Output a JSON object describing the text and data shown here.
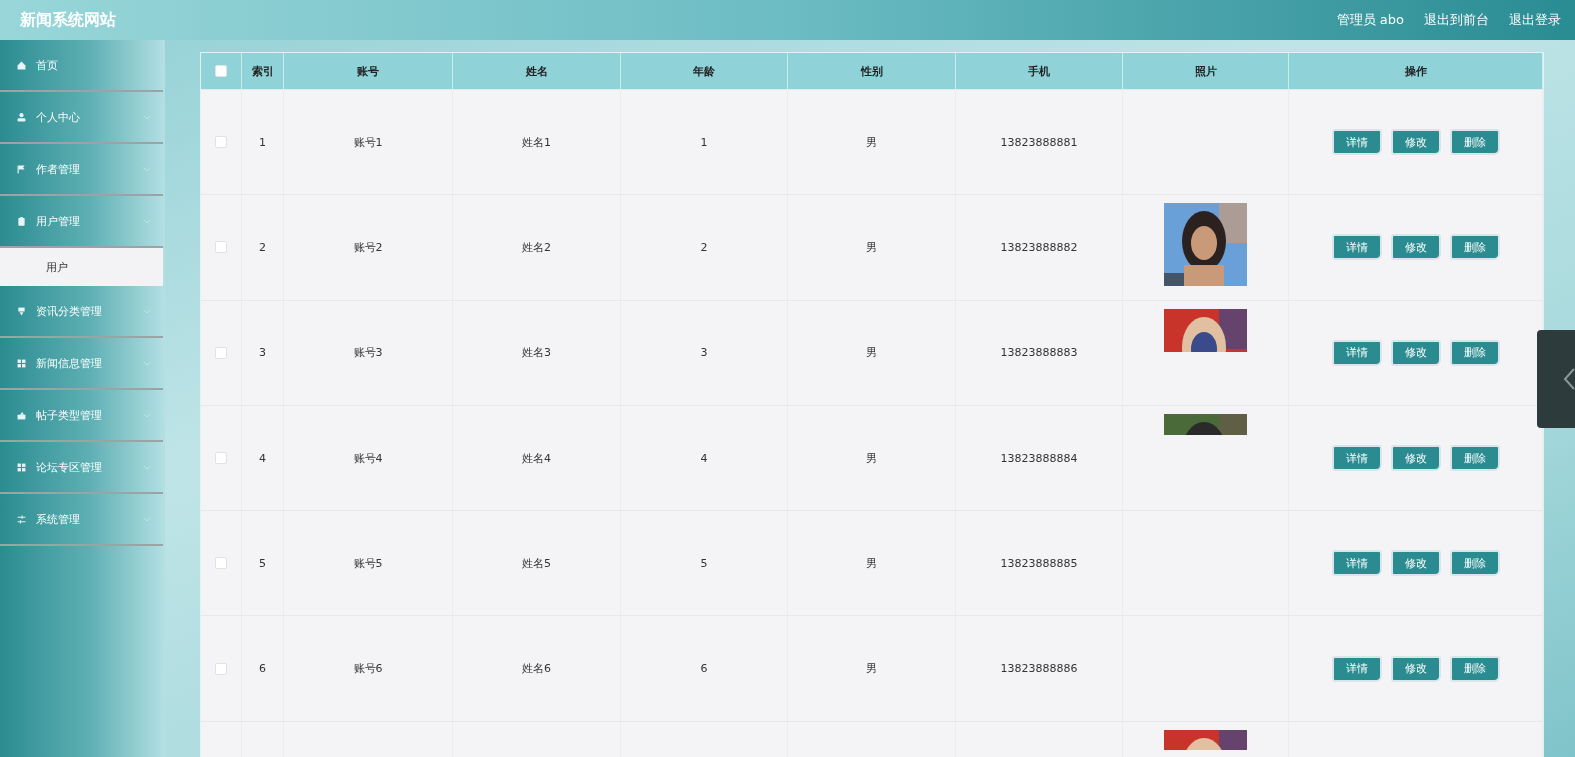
{
  "header": {
    "title": "新闻系统网站",
    "links": [
      {
        "label": "管理员 abo"
      },
      {
        "label": "退出到前台"
      },
      {
        "label": "退出登录"
      }
    ]
  },
  "sidebar": {
    "items": [
      {
        "label": "首页",
        "expandable": false
      },
      {
        "label": "个人中心",
        "expandable": true
      },
      {
        "label": "作者管理",
        "expandable": true
      },
      {
        "label": "用户管理",
        "expandable": true,
        "expanded": true,
        "children": [
          {
            "label": "用户",
            "selected": true
          }
        ]
      },
      {
        "label": "资讯分类管理",
        "expandable": true
      },
      {
        "label": "新闻信息管理",
        "expandable": true
      },
      {
        "label": "帖子类型管理",
        "expandable": true
      },
      {
        "label": "论坛专区管理",
        "expandable": true
      },
      {
        "label": "系统管理",
        "expandable": true
      }
    ]
  },
  "table": {
    "all_checked": false,
    "columns": [
      "索引",
      "账号",
      "姓名",
      "年龄",
      "性别",
      "手机",
      "照片",
      "操作"
    ],
    "rows": [
      {
        "checked": false,
        "index": "1",
        "account": "账号1",
        "name": "姓名1",
        "age": "1",
        "gender": "男",
        "phone": "13823888881",
        "actions": [
          "详情",
          "修改",
          "删除"
        ]
      },
      {
        "checked": false,
        "index": "2",
        "account": "账号2",
        "name": "姓名2",
        "age": "2",
        "gender": "男",
        "phone": "13823888882",
        "photo": {
          "kind": "picture"
        },
        "actions": [
          "详情",
          "修改",
          "删除"
        ]
      },
      {
        "checked": false,
        "index": "3",
        "account": "账号3",
        "name": "姓名3",
        "age": "3",
        "gender": "男",
        "phone": "13823888883",
        "photo": {
          "kind": "picture"
        },
        "actions": [
          "详情",
          "修改",
          "删除"
        ]
      },
      {
        "checked": false,
        "index": "4",
        "account": "账号4",
        "name": "姓名4",
        "age": "4",
        "gender": "男",
        "phone": "13823888884",
        "photo": {
          "kind": "picture"
        },
        "actions": [
          "详情",
          "修改",
          "删除"
        ]
      },
      {
        "checked": false,
        "index": "5",
        "account": "账号5",
        "name": "姓名5",
        "age": "5",
        "gender": "男",
        "phone": "13823888885",
        "actions": [
          "详情",
          "修改",
          "删除"
        ]
      },
      {
        "checked": false,
        "index": "6",
        "account": "账号6",
        "name": "姓名6",
        "age": "6",
        "gender": "男",
        "phone": "13823888886",
        "actions": [
          "详情",
          "修改",
          "删除"
        ]
      },
      {
        "photo": {
          "kind": "picture"
        }
      }
    ]
  },
  "side_tab": {
    "collapsed": true
  }
}
